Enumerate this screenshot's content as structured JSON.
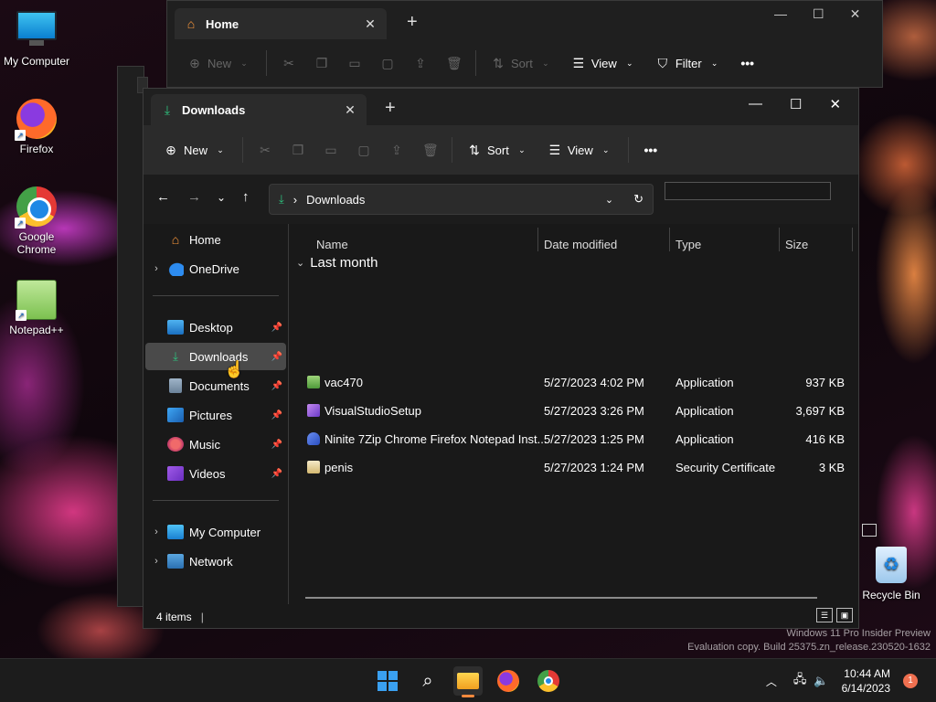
{
  "desktop": {
    "icons": [
      {
        "label": "My Computer",
        "icon": "monitor-icon"
      },
      {
        "label": "Firefox",
        "icon": "firefox-icon"
      },
      {
        "label": "Google Chrome",
        "icon": "chrome-icon"
      },
      {
        "label": "Notepad++",
        "icon": "notepadpp-icon"
      }
    ],
    "recycle_bin": "Recycle Bin",
    "watermark_line1": "Windows 11 Pro Insider Preview",
    "watermark_line2": "Evaluation copy. Build 25375.zn_release.230520-1632"
  },
  "back_window": {
    "tab_title": "Home",
    "toolbar": {
      "new": "New",
      "sort": "Sort",
      "view": "View",
      "filter": "Filter"
    }
  },
  "main_window": {
    "tab_title": "Downloads",
    "toolbar": {
      "new": "New",
      "sort": "Sort",
      "view": "View"
    },
    "address": {
      "path": "Downloads"
    },
    "nav": {
      "home": "Home",
      "onedrive": "OneDrive",
      "desktop": "Desktop",
      "downloads": "Downloads",
      "documents": "Documents",
      "pictures": "Pictures",
      "music": "Music",
      "videos": "Videos",
      "my_computer": "My Computer",
      "network": "Network"
    },
    "columns": {
      "name": "Name",
      "date": "Date modified",
      "type": "Type",
      "size": "Size"
    },
    "group": "Last month",
    "files": [
      {
        "name": "vac470",
        "date": "5/27/2023 4:02 PM",
        "type": "Application",
        "size": "937 KB"
      },
      {
        "name": "VisualStudioSetup",
        "date": "5/27/2023 3:26 PM",
        "type": "Application",
        "size": "3,697 KB"
      },
      {
        "name": "Ninite 7Zip Chrome Firefox Notepad Inst...",
        "date": "5/27/2023 1:25 PM",
        "type": "Application",
        "size": "416 KB"
      },
      {
        "name": "penis",
        "date": "5/27/2023 1:24 PM",
        "type": "Security Certificate",
        "size": "3 KB"
      }
    ],
    "status": "4 items"
  },
  "taskbar": {
    "time": "10:44 AM",
    "date": "6/14/2023",
    "notifications": "1"
  },
  "colors": {
    "accent": "#3aa0f0",
    "selection": "#4a4a4a",
    "downloads_green": "#2ec27e"
  }
}
